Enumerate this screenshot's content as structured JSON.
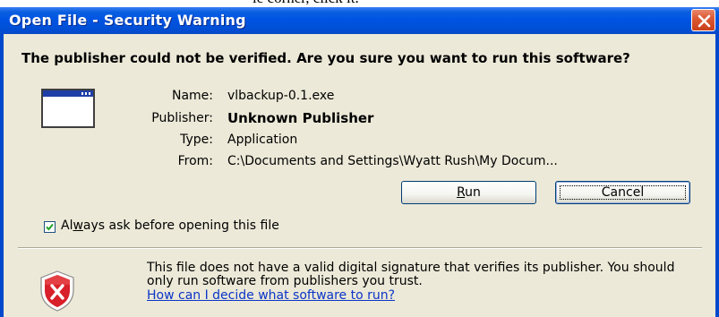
{
  "background_text": "le corner, click it.",
  "window": {
    "title": "Open File - Security Warning",
    "close_icon": "close-icon"
  },
  "dialog": {
    "heading": "The publisher could not be verified.  Are you sure you want to run this software?",
    "file_icon": "application-window-icon",
    "fields": [
      {
        "label": "Name:",
        "value": "vlbackup-0.1.exe"
      },
      {
        "label": "Publisher:",
        "value": "Unknown Publisher"
      },
      {
        "label": "Type:",
        "value": "Application"
      },
      {
        "label": "From:",
        "value": "C:\\Documents and Settings\\Wyatt Rush\\My Docum..."
      }
    ],
    "buttons": {
      "run": {
        "accel": "R",
        "rest": "un"
      },
      "cancel": "Cancel"
    },
    "checkbox": {
      "checked": true,
      "label_before": "Al",
      "label_accel": "w",
      "label_after": "ays ask before opening this file"
    },
    "warning": {
      "icon": "shield-warning-icon",
      "text": "This file does not have a valid digital signature that verifies its publisher.  You should only run software from publishers you trust.",
      "link": "How can I decide what software to run?"
    }
  },
  "colors": {
    "titlebar": "#0054e3",
    "dialog_bg": "#ece9d8",
    "link": "#0b35c8",
    "shield_red": "#d8202a"
  }
}
